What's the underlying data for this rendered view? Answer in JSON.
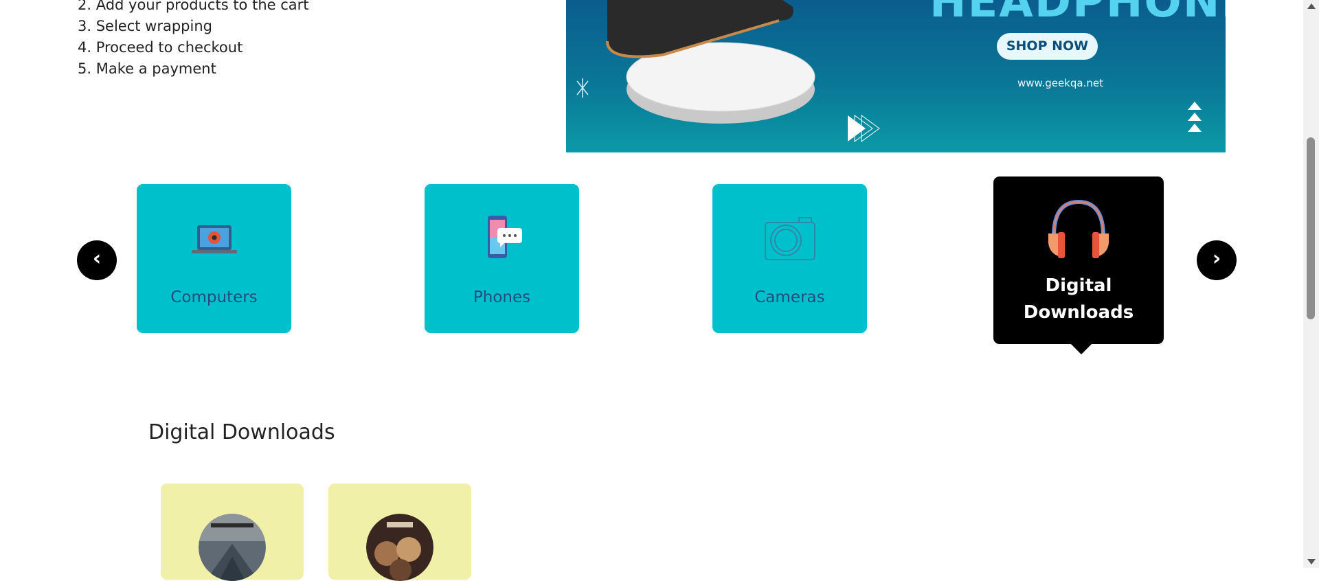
{
  "steps": [
    "2. Add your products to the cart",
    "3. Select wrapping",
    "4. Proceed to checkout",
    "5. Make a payment"
  ],
  "banner": {
    "headline": "HEADPHONE",
    "shop_label": "SHOP NOW",
    "website": "www.geekqa.net"
  },
  "carousel": {
    "prev_label": "‹",
    "next_label": "›",
    "categories": [
      {
        "label": "Computers",
        "icon": "laptop-icon"
      },
      {
        "label": "Phones",
        "icon": "smartphone-chat-icon"
      },
      {
        "label": "Cameras",
        "icon": "camera-icon"
      },
      {
        "label": "Digital Downloads",
        "icon": "headphones-icon",
        "active": true
      }
    ]
  },
  "section": {
    "title": "Digital Downloads"
  },
  "products": [
    {
      "art": "album-cover-night-visions-icon"
    },
    {
      "art": "album-cover-london-grammar-icon"
    }
  ],
  "colors": {
    "category_bg": "#00c0cc",
    "category_text": "#1e4e7e",
    "active_bg": "#000000",
    "product_bg": "#f0f0a8",
    "banner_dark": "#0a5d8d",
    "banner_light": "#0b9aa6"
  }
}
